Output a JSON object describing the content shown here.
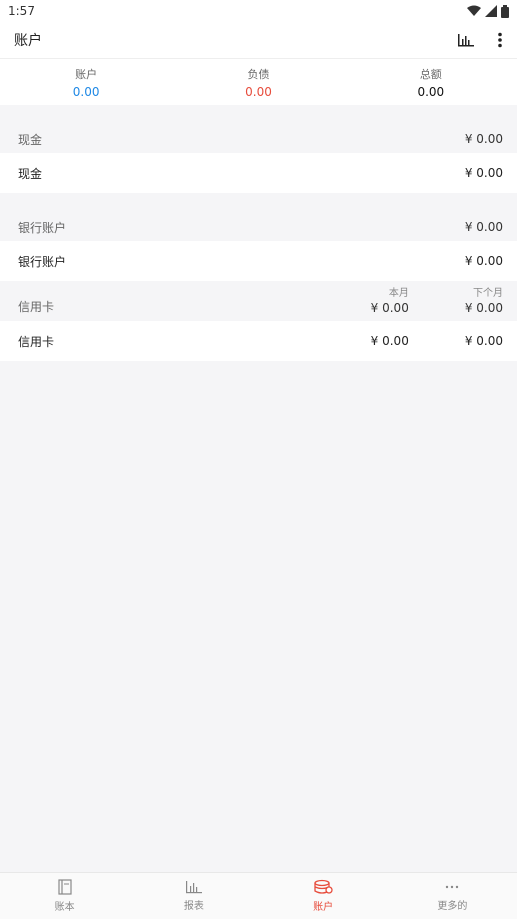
{
  "status": {
    "time": "1:57"
  },
  "app_bar": {
    "title": "账户"
  },
  "summary": [
    {
      "label": "账户",
      "value": "0.00"
    },
    {
      "label": "负债",
      "value": "0.00"
    },
    {
      "label": "总额",
      "value": "0.00"
    }
  ],
  "sections": {
    "cash": {
      "title": "现金",
      "total": "¥ 0.00",
      "rows": [
        {
          "name": "现金",
          "amount": "¥ 0.00"
        }
      ]
    },
    "bank": {
      "title": "银行账户",
      "total": "¥ 0.00",
      "rows": [
        {
          "name": "银行账户",
          "amount": "¥ 0.00"
        }
      ]
    },
    "credit": {
      "title": "信用卡",
      "col_this_month": "本月",
      "col_next_month": "下个月",
      "total_this_month": "¥ 0.00",
      "total_next_month": "¥ 0.00",
      "rows": [
        {
          "name": "信用卡",
          "this_month": "¥ 0.00",
          "next_month": "¥ 0.00"
        }
      ]
    }
  },
  "bottom_nav": [
    {
      "label": "账本",
      "icon": "book-icon"
    },
    {
      "label": "报表",
      "icon": "bar-chart-icon"
    },
    {
      "label": "账户",
      "icon": "coins-stack-icon",
      "active": true
    },
    {
      "label": "更多的",
      "icon": "more-dots-icon"
    }
  ],
  "colors": {
    "asset": "#1e88e5",
    "liability": "#e74c3c",
    "active_nav": "#e74c3c"
  }
}
